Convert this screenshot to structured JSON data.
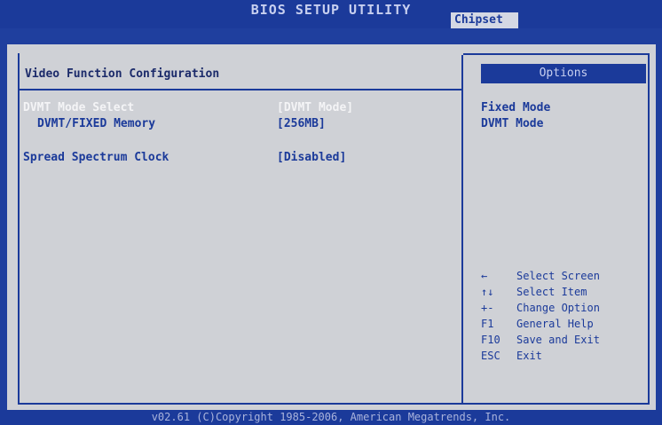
{
  "window": {
    "title": "BIOS SETUP UTILITY",
    "active_tab": "Chipset"
  },
  "section": {
    "title": "Video Function Configuration"
  },
  "settings": [
    {
      "label": "DVMT Mode Select",
      "value": "[DVMT Mode]"
    },
    {
      "label": "DVMT/FIXED Memory",
      "value": "[256MB]"
    },
    {
      "label": "Spread Spectrum Clock",
      "value": "[Disabled]"
    }
  ],
  "options": {
    "header": "Options",
    "items": [
      "Fixed Mode",
      "DVMT Mode"
    ]
  },
  "help": [
    {
      "key": "←",
      "action": "Select Screen"
    },
    {
      "key": "↑↓",
      "action": "Select Item"
    },
    {
      "key": "+-",
      "action": "Change Option"
    },
    {
      "key": "F1",
      "action": "General Help"
    },
    {
      "key": "F10",
      "action": "Save and Exit"
    },
    {
      "key": "ESC",
      "action": "Exit"
    }
  ],
  "footer": "v02.61 (C)Copyright 1985-2006, American Megatrends, Inc."
}
